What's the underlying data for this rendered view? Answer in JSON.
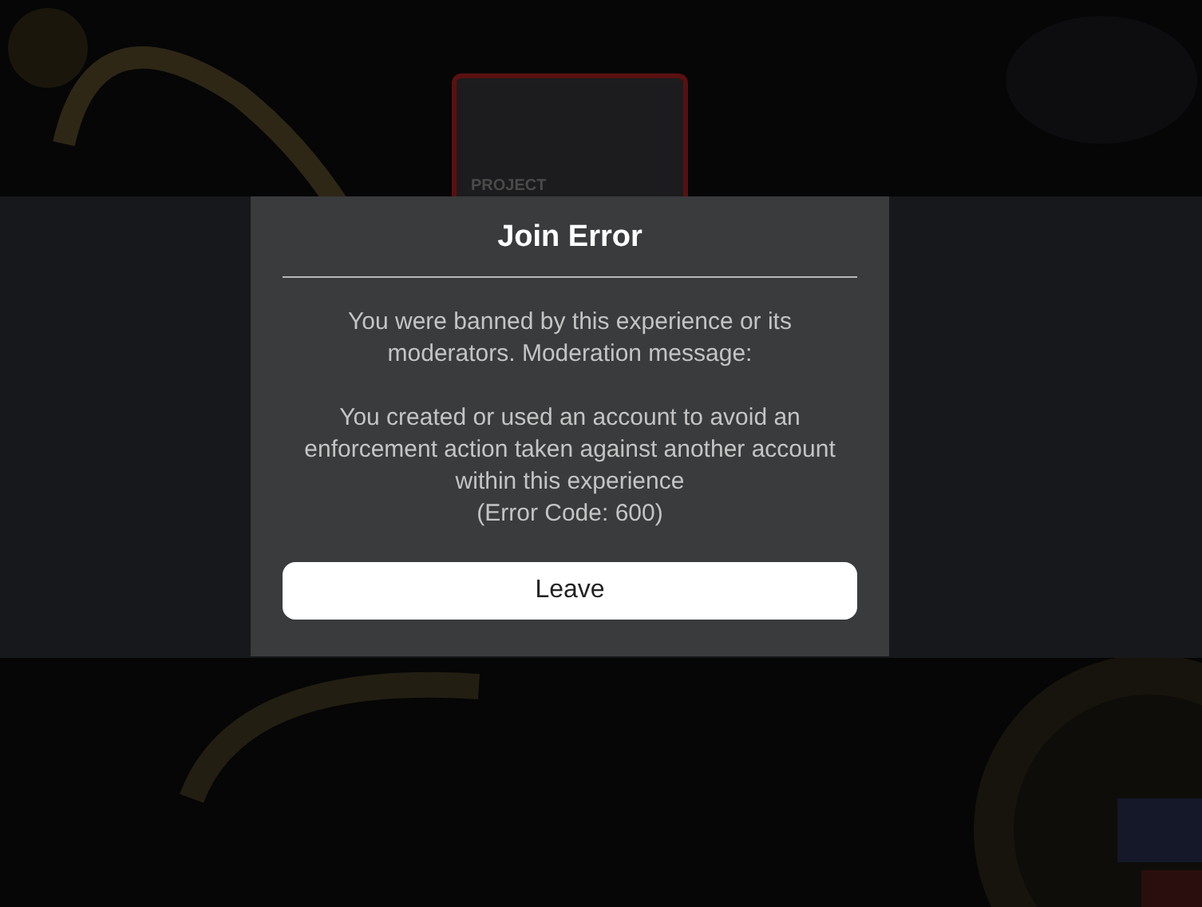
{
  "background": {
    "thumbnail_label": "PROJECT"
  },
  "dialog": {
    "title": "Join Error",
    "message": [
      "You were banned by this experience or its moderators. Moderation message:",
      "You created or used an account to avoid an enforcement action taken against another account within this experience"
    ],
    "error_code": "(Error Code: 600)",
    "buttons": [
      "Leave"
    ]
  }
}
